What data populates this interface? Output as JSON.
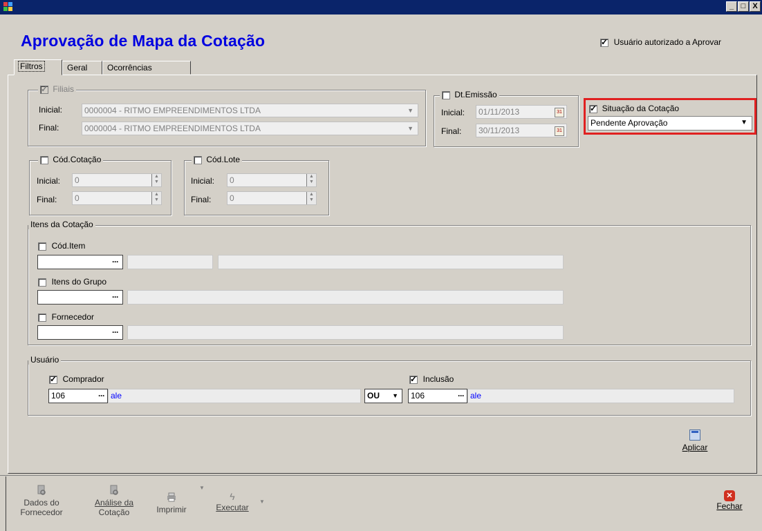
{
  "window": {
    "min": "_",
    "max": "□",
    "close": "X"
  },
  "header": {
    "title": "Aprovação de Mapa da Cotação",
    "authorized_label": "Usuário autorizado a Aprovar",
    "authorized_checked": true
  },
  "tabs": [
    {
      "label": "Filtros"
    },
    {
      "label": "Geral"
    },
    {
      "label": "Ocorrências"
    }
  ],
  "filiais": {
    "label": "Filiais",
    "inicial_label": "Inicial:",
    "inicial_value": "0000004 - RITMO EMPREENDIMENTOS LTDA",
    "final_label": "Final:",
    "final_value": "0000004 - RITMO EMPREENDIMENTOS LTDA"
  },
  "dt_emissao": {
    "label": "Dt.Emissão",
    "inicial_label": "Inicial:",
    "inicial_value": "01/11/2013",
    "final_label": "Final:",
    "final_value": "30/11/2013"
  },
  "situacao": {
    "label": "Situação da Cotação",
    "value": "Pendente Aprovação"
  },
  "cod_cotacao": {
    "label": "Cód.Cotação",
    "inicial_label": "Inicial:",
    "inicial_value": "0",
    "final_label": "Final:",
    "final_value": "0"
  },
  "cod_lote": {
    "label": "Cód.Lote",
    "inicial_label": "Inicial:",
    "inicial_value": "0",
    "final_label": "Final:",
    "final_value": "0"
  },
  "itens": {
    "label": "Itens da Cotação",
    "cod_item_label": "Cód.Item",
    "itens_grupo_label": "Itens do Grupo",
    "fornecedor_label": "Fornecedor",
    "lookup": "···"
  },
  "usuario": {
    "label": "Usuário",
    "comprador_label": "Comprador",
    "comprador_code": "106",
    "comprador_name": "ale",
    "operator": "OU",
    "inclusao_label": "Inclusão",
    "inclusao_code": "106",
    "inclusao_name": "ale",
    "lookup": "···"
  },
  "aplicar": {
    "label": "Aplicar"
  },
  "toolbar": {
    "dados_line1": "Dados do",
    "dados_line2": "Fornecedor",
    "analise_line1": "Análise da",
    "analise_line2": "Cotação",
    "imprimir": "Imprimir",
    "executar": "Executar",
    "fechar": "Fechar"
  }
}
